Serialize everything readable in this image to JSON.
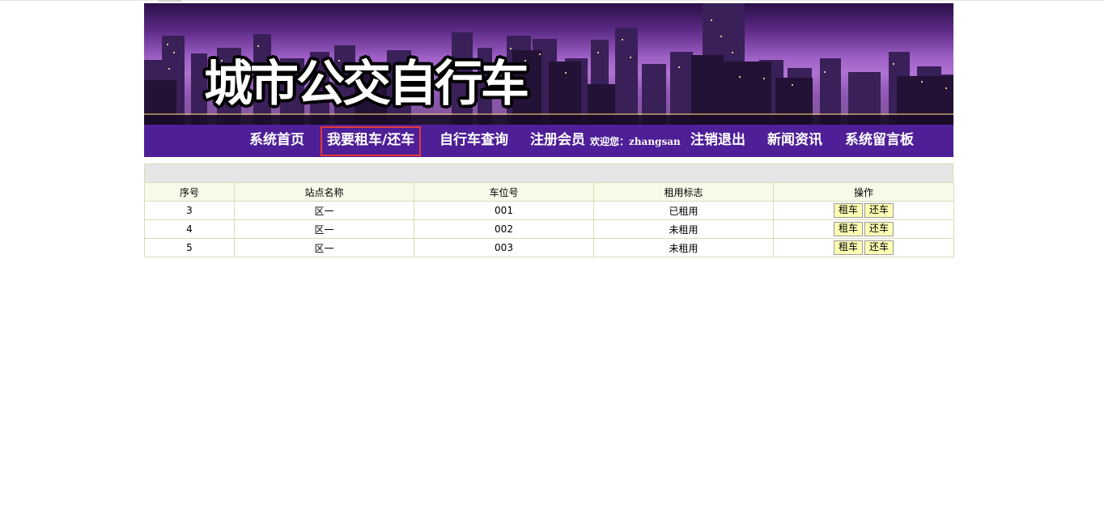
{
  "banner": {
    "title": "城市公交自行车"
  },
  "nav": {
    "items": [
      "系统首页",
      "我要租车/还车",
      "自行车查询",
      "注册会员",
      "注销退出",
      "新闻资讯",
      "系统留言板"
    ],
    "welcome_prefix": "欢迎您：",
    "username": "zhangsan"
  },
  "table": {
    "headers": [
      "序号",
      "站点名称",
      "车位号",
      "租用标志",
      "操作"
    ],
    "rows": [
      {
        "id": "3",
        "station": "区一",
        "slot": "001",
        "status": "已租用"
      },
      {
        "id": "4",
        "station": "区一",
        "slot": "002",
        "status": "未租用"
      },
      {
        "id": "5",
        "station": "区一",
        "slot": "003",
        "status": "未租用"
      }
    ],
    "rent_label": "租车",
    "return_label": "还车"
  },
  "colors": {
    "nav_bg": "#4e1f97",
    "active_border": "#e53935",
    "button_bg": "#ffffb4",
    "header_bg": "#f9f9ea"
  }
}
